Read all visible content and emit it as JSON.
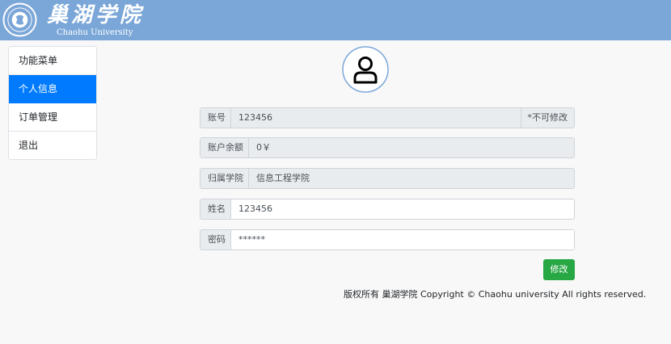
{
  "brand": {
    "name_cn": "巢湖学院",
    "name_en": "Chaohu University"
  },
  "sidebar": {
    "items": [
      {
        "label": "功能菜单"
      },
      {
        "label": "个人信息"
      },
      {
        "label": "订单管理"
      },
      {
        "label": "退出"
      }
    ]
  },
  "profile": {
    "account": {
      "label": "账号",
      "value": "123456",
      "suffix": "*不可修改"
    },
    "balance": {
      "label": "账户余额",
      "value": "0￥"
    },
    "college": {
      "label": "归属学院",
      "value": "信息工程学院"
    },
    "name": {
      "label": "姓名",
      "value": "123456"
    },
    "password": {
      "label": "密码",
      "value": "******"
    }
  },
  "actions": {
    "save_label": "修改"
  },
  "footer": {
    "copyright": "版权所有 巢湖学院 Copyright © Chaohu university All rights reserved."
  },
  "colors": {
    "header": "#7ba7d8",
    "active": "#007bff",
    "save": "#28a745"
  }
}
